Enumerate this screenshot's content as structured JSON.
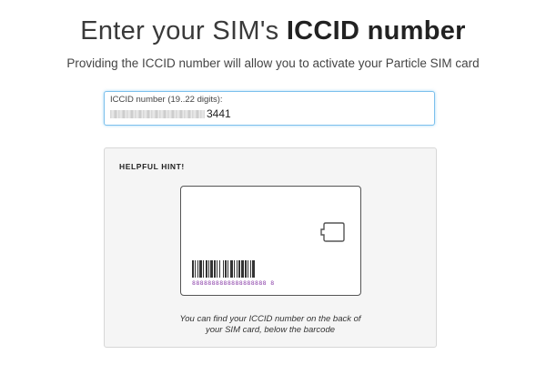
{
  "header": {
    "title_prefix": "Enter your SIM's ",
    "title_bold": "ICCID number",
    "subtitle": "Providing the ICCID number will allow you to activate your Particle SIM card"
  },
  "iccid_field": {
    "label": "ICCID number (19..22 digits):",
    "value_visible_suffix": "3441"
  },
  "hint": {
    "title": "HELPFUL HINT!",
    "barcode_number": "8888888888888888888 8",
    "caption_line1": "You can find your ICCID number on the back of",
    "caption_line2": "your SIM card, below the barcode"
  },
  "colors": {
    "field_border": "#7cc0ec",
    "barcode_number": "#8a3ea8",
    "hint_background": "#f5f5f5"
  }
}
